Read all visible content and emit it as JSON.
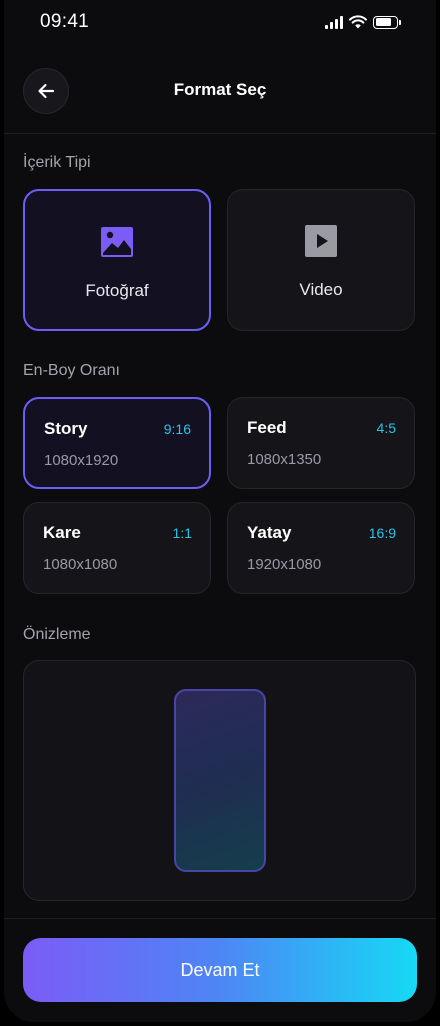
{
  "status_bar": {
    "time": "09:41"
  },
  "header": {
    "title": "Format Seç"
  },
  "content_type": {
    "label": "İçerik Tipi",
    "options": [
      {
        "label": "Fotoğraf",
        "icon": "image-icon",
        "selected": true
      },
      {
        "label": "Video",
        "icon": "play-icon",
        "selected": false
      }
    ]
  },
  "aspect_ratio": {
    "label": "En-Boy Oranı",
    "options": [
      {
        "name": "Story",
        "ratio": "9:16",
        "size": "1080x1920",
        "selected": true
      },
      {
        "name": "Feed",
        "ratio": "4:5",
        "size": "1080x1350",
        "selected": false
      },
      {
        "name": "Kare",
        "ratio": "1:1",
        "size": "1080x1080",
        "selected": false
      },
      {
        "name": "Yatay",
        "ratio": "16:9",
        "size": "1920x1080",
        "selected": false
      }
    ]
  },
  "preview": {
    "label": "Önizleme"
  },
  "footer": {
    "continue_label": "Devam Et"
  },
  "colors": {
    "accent_purple": "#6d5ef5",
    "accent_cyan": "#2bc4e6",
    "background": "#0c0c0f"
  }
}
